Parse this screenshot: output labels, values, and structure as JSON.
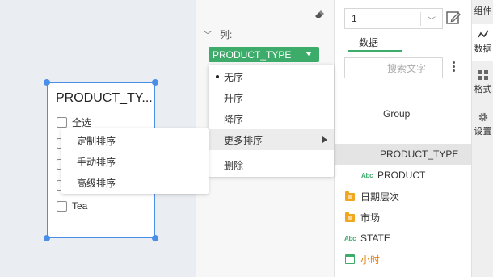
{
  "canvas": {
    "widget": {
      "title": "PRODUCT_TY...",
      "items": [
        "全选",
        "",
        "",
        "",
        "Tea"
      ]
    }
  },
  "property_panel": {
    "column_label": "列:",
    "field_pill": "PRODUCT_TYPE"
  },
  "sort_menu": {
    "items": [
      {
        "label": "无序",
        "selected": true
      },
      {
        "label": "升序",
        "selected": false
      },
      {
        "label": "降序",
        "selected": false
      },
      {
        "label": "更多排序",
        "has_submenu": true
      },
      {
        "label": "删除"
      }
    ]
  },
  "submenu": {
    "items": [
      "定制排序",
      "手动排序",
      "高级排序"
    ]
  },
  "data_panel": {
    "number_select_value": "1",
    "tab_label": "数据",
    "search_placeholder": "搜索文字",
    "tree": [
      {
        "label": "Group",
        "icon": "none"
      },
      {
        "label": "PRODUCT_TYPE",
        "icon": "abc-icon",
        "selected": true
      },
      {
        "label": "PRODUCT",
        "icon": "abc-icon"
      },
      {
        "label": "日期层次",
        "icon": "folder-icon"
      },
      {
        "label": "市场",
        "icon": "folder-icon"
      },
      {
        "label": "STATE",
        "icon": "abc-icon"
      },
      {
        "label": "小时",
        "icon": "calendar-icon",
        "color": "#e8820c"
      }
    ],
    "abc_text": "Abc"
  },
  "rail": {
    "items": [
      "组件",
      "数据",
      "格式",
      "设置"
    ]
  },
  "colors": {
    "accent_green": "#3dab6a",
    "selection_blue": "#4a8fe7",
    "orange": "#e8820c",
    "folder": "#f0a61e"
  }
}
